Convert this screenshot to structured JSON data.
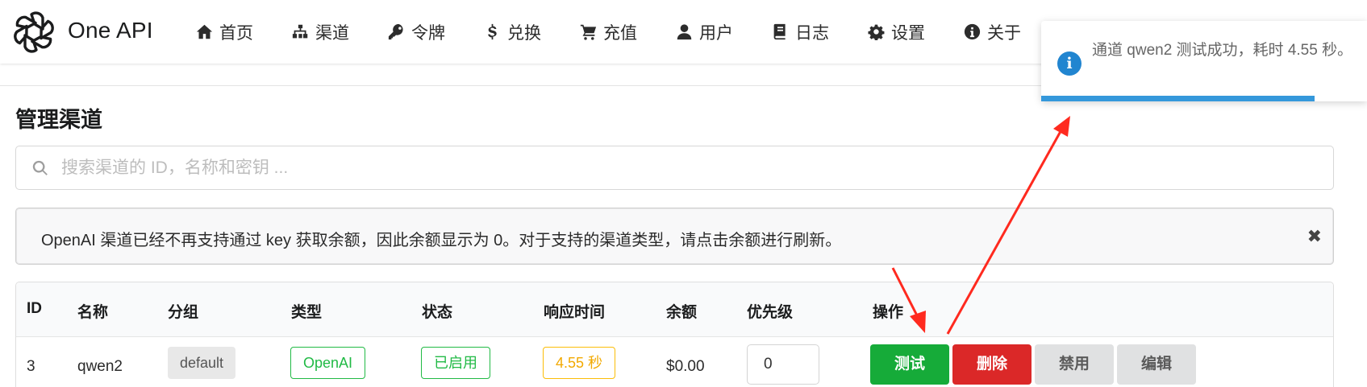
{
  "app": {
    "brand": "One API"
  },
  "nav": {
    "items": [
      {
        "label": "首页",
        "icon": "home-icon"
      },
      {
        "label": "渠道",
        "icon": "sitemap-icon"
      },
      {
        "label": "令牌",
        "icon": "key-icon"
      },
      {
        "label": "兑换",
        "icon": "dollar-icon"
      },
      {
        "label": "充值",
        "icon": "cart-icon"
      },
      {
        "label": "用户",
        "icon": "user-icon"
      },
      {
        "label": "日志",
        "icon": "book-icon"
      },
      {
        "label": "设置",
        "icon": "gear-icon"
      },
      {
        "label": "关于",
        "icon": "info-icon"
      }
    ]
  },
  "page": {
    "title": "管理渠道"
  },
  "search": {
    "placeholder": "搜索渠道的 ID，名称和密钥 ..."
  },
  "message": {
    "text": "OpenAI 渠道已经不再支持通过 key 获取余额，因此余额显示为 0。对于支持的渠道类型，请点击余额进行刷新。",
    "close": "✖"
  },
  "table": {
    "headers": [
      "ID",
      "名称",
      "分组",
      "类型",
      "状态",
      "响应时间",
      "余额",
      "优先级",
      "操作"
    ],
    "rows": [
      {
        "id": "3",
        "name": "qwen2",
        "group": "default",
        "type": "OpenAI",
        "status": "已启用",
        "response_time": "4.55 秒",
        "balance": "$0.00",
        "priority": "0",
        "actions": {
          "test": "测试",
          "delete": "删除",
          "disable": "禁用",
          "edit": "编辑"
        }
      }
    ]
  },
  "toast": {
    "icon": "i",
    "text": "通道 qwen2 测试成功，耗时 4.55 秒。",
    "progress": 0.84
  },
  "colors": {
    "accent_green": "#16ab39",
    "danger_red": "#db2828",
    "info_blue": "#2185d0",
    "status_green": "#21ba45",
    "warning_yellow": "#fbbd08",
    "annotation_red": "#ff2a1f"
  }
}
